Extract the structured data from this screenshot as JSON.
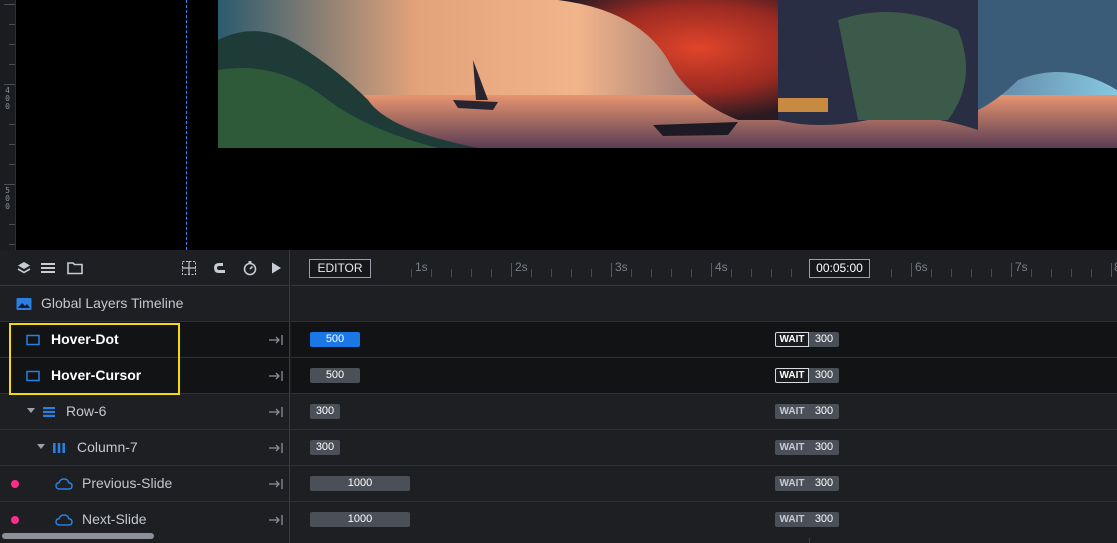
{
  "canvas": {
    "ruler_labels": [
      "400",
      "500"
    ]
  },
  "toolbar": {
    "left_icons": [
      "layers-icon",
      "list-icon",
      "folder-icon"
    ],
    "right_icons": [
      "grid-snap-icon",
      "magnet-icon",
      "stopwatch-icon",
      "play-icon"
    ]
  },
  "timeline": {
    "editor_label": "EDITOR",
    "current_time": "00:05:00",
    "seconds": [
      "1s",
      "2s",
      "3s",
      "4s",
      "6s",
      "7s",
      "8"
    ]
  },
  "rows": [
    {
      "label": "Global Layers Timeline",
      "icon": "image-icon"
    },
    {
      "label": "Hover-Dot",
      "icon": "square-layer-icon",
      "bar": "500",
      "wait": "WAIT",
      "wait_value": "300"
    },
    {
      "label": "Hover-Cursor",
      "icon": "square-layer-icon",
      "bar": "500",
      "wait": "WAIT",
      "wait_value": "300"
    },
    {
      "label": "Row-6",
      "icon": "row-icon",
      "bar": "300",
      "wait": "WAIT",
      "wait_value": "300"
    },
    {
      "label": "Column-7",
      "icon": "column-icon",
      "bar": "300",
      "wait": "WAIT",
      "wait_value": "300"
    },
    {
      "label": "Previous-Slide",
      "icon": "cloud-icon",
      "bar": "1000",
      "wait": "WAIT",
      "wait_value": "300"
    },
    {
      "label": "Next-Slide",
      "icon": "cloud-icon",
      "bar": "1000",
      "wait": "WAIT",
      "wait_value": "300"
    }
  ],
  "colors": {
    "accent_blue": "#1a78e6",
    "selection_yellow": "#f5d90a",
    "marker_pink": "#ff2d87"
  }
}
